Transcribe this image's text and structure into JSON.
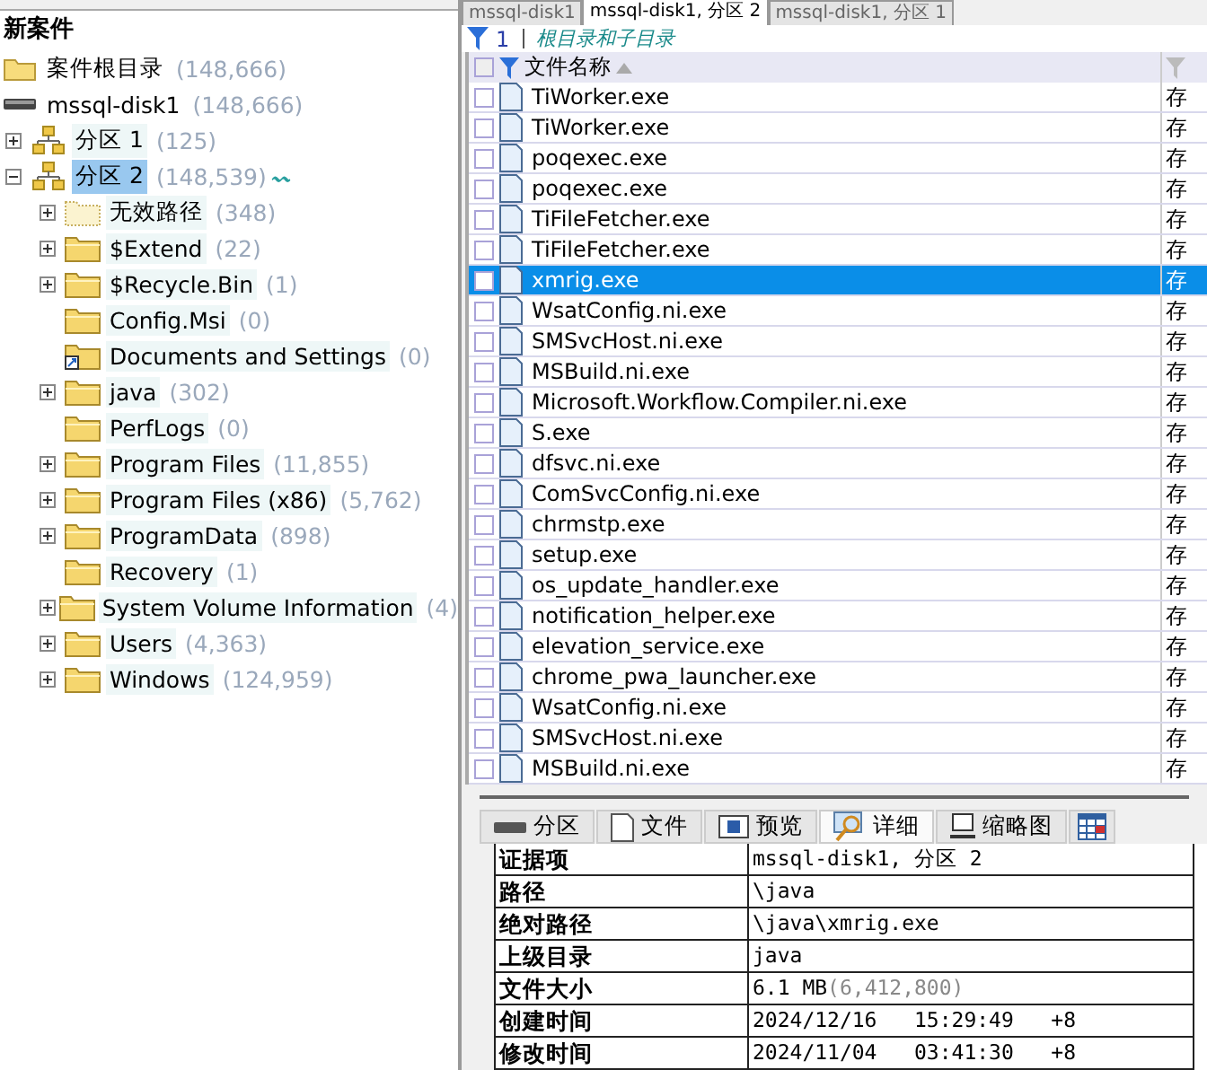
{
  "tabs": [
    {
      "label": "mssql-disk1",
      "selected": false
    },
    {
      "label": "mssql-disk1, 分区 2",
      "selected": true
    },
    {
      "label": "mssql-disk1, 分区 1",
      "selected": false
    }
  ],
  "tree": {
    "title": "新案件",
    "items": [
      {
        "kind": "folder",
        "label": "案件根目录",
        "count": "(148,666)",
        "selected": false
      },
      {
        "kind": "drive",
        "label": "mssql-disk1",
        "count": "(148,666)",
        "selected": false,
        "children": [
          {
            "kind": "partition",
            "label": "分区 1",
            "count": "(125)",
            "expandable": true,
            "expanded": false,
            "selected": false
          },
          {
            "kind": "partition",
            "label": "分区 2",
            "count": "(148,539)",
            "expandable": true,
            "expanded": true,
            "selected": true,
            "trail": "〰",
            "children": [
              {
                "kind": "invalid",
                "label": "无效路径",
                "count": "(348)",
                "expandable": true,
                "expanded": false,
                "selected": false
              },
              {
                "kind": "folder",
                "label": "$Extend",
                "count": "(22)",
                "expandable": true,
                "expanded": false,
                "selected": false
              },
              {
                "kind": "folder",
                "label": "$Recycle.Bin",
                "count": "(1)",
                "expandable": true,
                "expanded": false,
                "selected": false
              },
              {
                "kind": "folder",
                "label": "Config.Msi",
                "count": "(0)",
                "expandable": false,
                "selected": false
              },
              {
                "kind": "shortcut",
                "label": "Documents and Settings",
                "count": "(0)",
                "expandable": false,
                "selected": false
              },
              {
                "kind": "folder",
                "label": "java",
                "count": "(302)",
                "expandable": true,
                "expanded": false,
                "selected": false
              },
              {
                "kind": "folder",
                "label": "PerfLogs",
                "count": "(0)",
                "expandable": false,
                "selected": false
              },
              {
                "kind": "folder",
                "label": "Program Files",
                "count": "(11,855)",
                "expandable": true,
                "expanded": false,
                "selected": false
              },
              {
                "kind": "folder",
                "label": "Program Files (x86)",
                "count": "(5,762)",
                "expandable": true,
                "expanded": false,
                "selected": false
              },
              {
                "kind": "folder",
                "label": "ProgramData",
                "count": "(898)",
                "expandable": true,
                "expanded": false,
                "selected": false
              },
              {
                "kind": "folder",
                "label": "Recovery",
                "count": "(1)",
                "expandable": false,
                "selected": false
              },
              {
                "kind": "folder",
                "label": "System Volume Information",
                "count": "(4)",
                "expandable": true,
                "expanded": false,
                "selected": false
              },
              {
                "kind": "folder",
                "label": "Users",
                "count": "(4,363)",
                "expandable": true,
                "expanded": false,
                "selected": false
              },
              {
                "kind": "folder",
                "label": "Windows",
                "count": "(124,959)",
                "expandable": true,
                "expanded": false,
                "selected": false
              }
            ]
          }
        ]
      }
    ]
  },
  "filter_bar": {
    "count": "1",
    "scope": "根目录和子目录"
  },
  "file_table": {
    "columns": [
      "文件名称"
    ],
    "header_checked": false,
    "rows": [
      {
        "name": "TiWorker.exe",
        "column_2": "存",
        "checked": false,
        "selected": false
      },
      {
        "name": "TiWorker.exe",
        "column_2": "存",
        "checked": false,
        "selected": false
      },
      {
        "name": "poqexec.exe",
        "column_2": "存",
        "checked": false,
        "selected": false
      },
      {
        "name": "poqexec.exe",
        "column_2": "存",
        "checked": false,
        "selected": false
      },
      {
        "name": "TiFileFetcher.exe",
        "column_2": "存",
        "checked": false,
        "selected": false
      },
      {
        "name": "TiFileFetcher.exe",
        "column_2": "存",
        "checked": false,
        "selected": false
      },
      {
        "name": "xmrig.exe",
        "column_2": "存",
        "checked": false,
        "selected": true
      },
      {
        "name": "WsatConfig.ni.exe",
        "column_2": "存",
        "checked": false,
        "selected": false
      },
      {
        "name": "SMSvcHost.ni.exe",
        "column_2": "存",
        "checked": false,
        "selected": false
      },
      {
        "name": "MSBuild.ni.exe",
        "column_2": "存",
        "checked": false,
        "selected": false
      },
      {
        "name": "Microsoft.Workflow.Compiler.ni.exe",
        "column_2": "存",
        "checked": false,
        "selected": false
      },
      {
        "name": "S.exe",
        "column_2": "存",
        "checked": false,
        "selected": false
      },
      {
        "name": "dfsvc.ni.exe",
        "column_2": "存",
        "checked": false,
        "selected": false
      },
      {
        "name": "ComSvcConfig.ni.exe",
        "column_2": "存",
        "checked": false,
        "selected": false
      },
      {
        "name": "chrmstp.exe",
        "column_2": "存",
        "checked": false,
        "selected": false
      },
      {
        "name": "setup.exe",
        "column_2": "存",
        "checked": false,
        "selected": false
      },
      {
        "name": "os_update_handler.exe",
        "column_2": "存",
        "checked": false,
        "selected": false
      },
      {
        "name": "notification_helper.exe",
        "column_2": "存",
        "checked": false,
        "selected": false
      },
      {
        "name": "elevation_service.exe",
        "column_2": "存",
        "checked": false,
        "selected": false
      },
      {
        "name": "chrome_pwa_launcher.exe",
        "column_2": "存",
        "checked": false,
        "selected": false
      },
      {
        "name": "WsatConfig.ni.exe",
        "column_2": "存",
        "checked": false,
        "selected": false
      },
      {
        "name": "SMSvcHost.ni.exe",
        "column_2": "存",
        "checked": false,
        "selected": false
      },
      {
        "name": "MSBuild.ni.exe",
        "column_2": "存",
        "checked": false,
        "selected": false
      }
    ]
  },
  "view_tabs": [
    {
      "kind": "partition",
      "label": "分区",
      "selected": false
    },
    {
      "kind": "file",
      "label": "文件",
      "selected": false
    },
    {
      "kind": "preview",
      "label": "预览",
      "selected": false
    },
    {
      "kind": "details",
      "label": "详细",
      "selected": true
    },
    {
      "kind": "thumbnails",
      "label": "缩略图",
      "selected": false
    },
    {
      "kind": "calendar",
      "selected": false
    }
  ],
  "details": [
    {
      "label": "证据项",
      "value": "mssql-disk1, 分区 2"
    },
    {
      "label": "路径",
      "value": "\\java"
    },
    {
      "label": "绝对路径",
      "value": "\\java\\xmrig.exe"
    },
    {
      "label": "上级目录",
      "value": "java"
    },
    {
      "label": "文件大小",
      "value": "6.1 MB",
      "note": "(6,412,800)"
    },
    {
      "label": "创建时间",
      "value": "2024/12/16   15:29:49   +8"
    },
    {
      "label": "修改时间",
      "value": "2024/11/04   03:41:30   +8"
    }
  ]
}
